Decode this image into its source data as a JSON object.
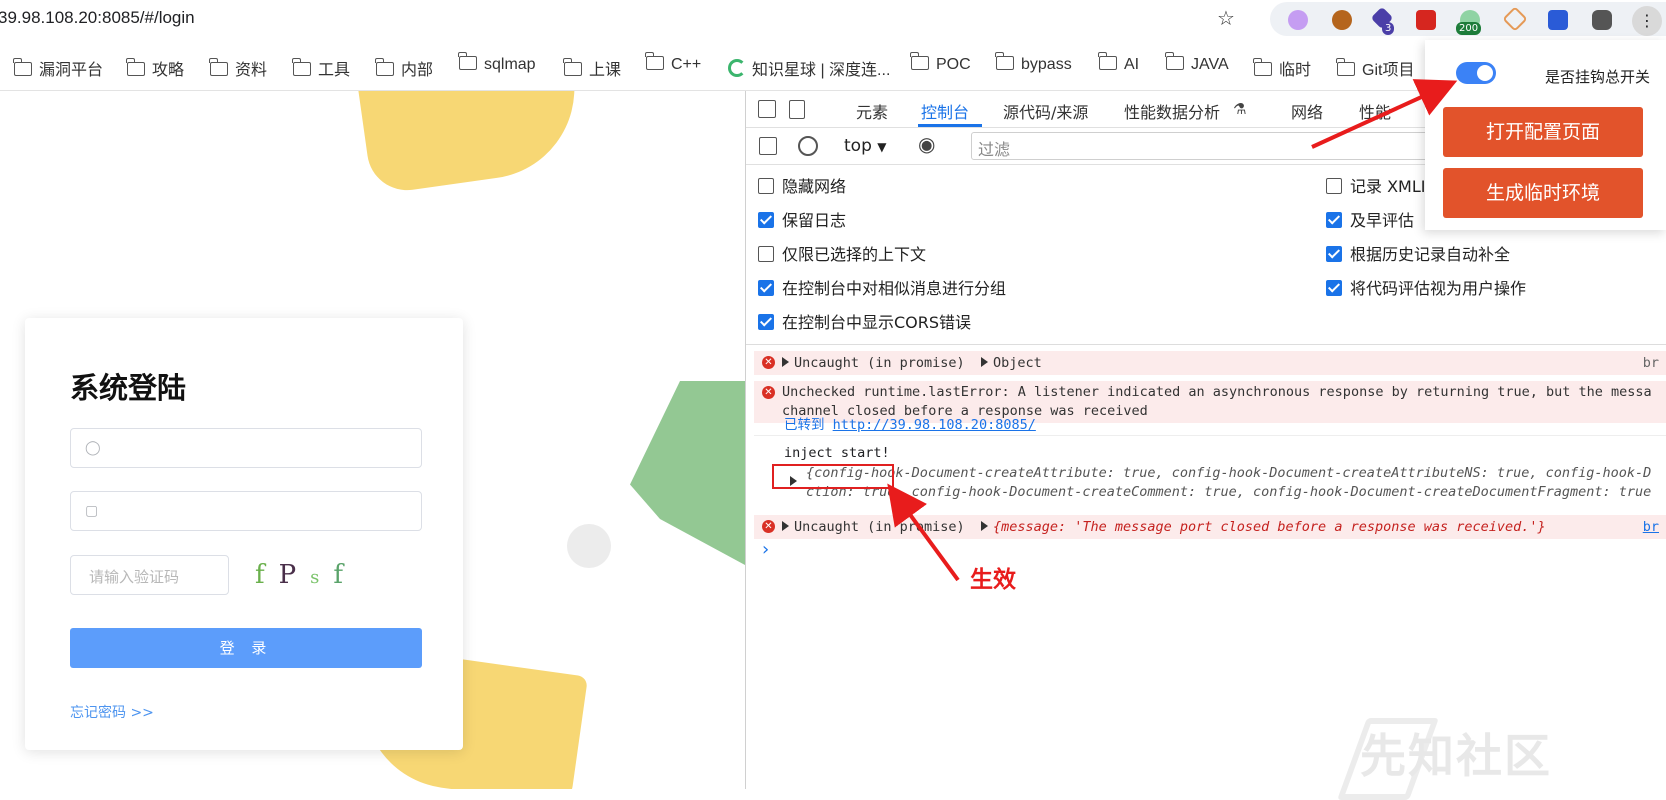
{
  "browser": {
    "url": "39.98.108.20:8085/#/login",
    "extensions": [
      {
        "icon": "pink-circle-icon",
        "color": "#c59df2"
      },
      {
        "icon": "cookie-icon",
        "color": "#a0522d"
      },
      {
        "icon": "cube-icon",
        "color": "#4b3fa8",
        "badge": "3"
      },
      {
        "icon": "flag-icon",
        "color": "#d6261f"
      },
      {
        "icon": "network-icon",
        "color": "#3aa757",
        "badge": "200"
      },
      {
        "icon": "diamond-icon",
        "color": "#e59a57"
      },
      {
        "icon": "floppy-icon",
        "color": "#2a5bd7"
      },
      {
        "icon": "sunglasses-icon",
        "color": "#333333"
      }
    ],
    "corner_glyph": "⋮",
    "bookmarks": [
      {
        "label": "漏洞平台",
        "type": "folder"
      },
      {
        "label": "攻略",
        "type": "folder"
      },
      {
        "label": "资料",
        "type": "folder"
      },
      {
        "label": "工具",
        "type": "folder"
      },
      {
        "label": "内部",
        "type": "folder"
      },
      {
        "label": "sqlmap",
        "type": "folder"
      },
      {
        "label": "上课",
        "type": "folder"
      },
      {
        "label": "C++",
        "type": "folder"
      },
      {
        "label": "知识星球 | 深度连...",
        "type": "link"
      },
      {
        "label": "POC",
        "type": "folder"
      },
      {
        "label": "bypass",
        "type": "folder"
      },
      {
        "label": "AI",
        "type": "folder"
      },
      {
        "label": "JAVA",
        "type": "folder"
      },
      {
        "label": "临时",
        "type": "folder"
      },
      {
        "label": "Git项目",
        "type": "folder"
      }
    ]
  },
  "login": {
    "title": "系统登陆",
    "captcha_placeholder": "请输入验证码",
    "captcha_chars": [
      "f",
      "P",
      "s",
      "f"
    ],
    "login_button": "登 录",
    "forgot_link": "忘记密码 >>"
  },
  "devtools": {
    "tabs": [
      "元素",
      "控制台",
      "源代码/来源",
      "性能数据分析",
      "网络",
      "性能"
    ],
    "active_tab": "控制台",
    "context": "top",
    "filter_placeholder": "过滤",
    "settings_left": [
      {
        "label": "隐藏网络",
        "checked": false
      },
      {
        "label": "保留日志",
        "checked": true
      },
      {
        "label": "仅限已选择的上下文",
        "checked": false
      },
      {
        "label": "在控制台中对相似消息进行分组",
        "checked": true
      },
      {
        "label": "在控制台中显示CORS错误",
        "checked": true
      }
    ],
    "settings_right": [
      {
        "label": "记录 XMLI",
        "checked": false
      },
      {
        "label": "及早评估",
        "checked": true
      },
      {
        "label": "根据历史记录自动补全",
        "checked": true
      },
      {
        "label": "将代码评估视为用户操作",
        "checked": true
      }
    ],
    "logs": {
      "err1": "Uncaught (in promise)",
      "err1_obj": "Object",
      "err1_src": "br",
      "err2_line1": "Unchecked runtime.lastError: A listener indicated an asynchronous response by returning true, but the messa",
      "err2_line2": "channel closed before a response was received",
      "nav_prefix": "已转到",
      "nav_url": "http://39.98.108.20:8085/",
      "inject": "inject start!",
      "obj_line1": "{config-hook-Document-createAttribute: true, config-hook-Document-createAttributeNS: true, config-hook-D",
      "obj_line2": "ction: true, config-hook-Document-createComment: true, config-hook-Document-createDocumentFragment: true",
      "err3": "Uncaught (in promise)",
      "err3_obj": "{message: 'The message port closed before a response was received.'}",
      "err3_src": "br",
      "prompt": "›"
    }
  },
  "popup": {
    "toggle_label": "是否挂钩总开关",
    "toggle_on": true,
    "open_config_button": "打开配置页面",
    "gen_env_button": "生成临时环境"
  },
  "annotation": {
    "label": "生效",
    "color": "#e81c1c"
  },
  "watermark": "先知社区"
}
